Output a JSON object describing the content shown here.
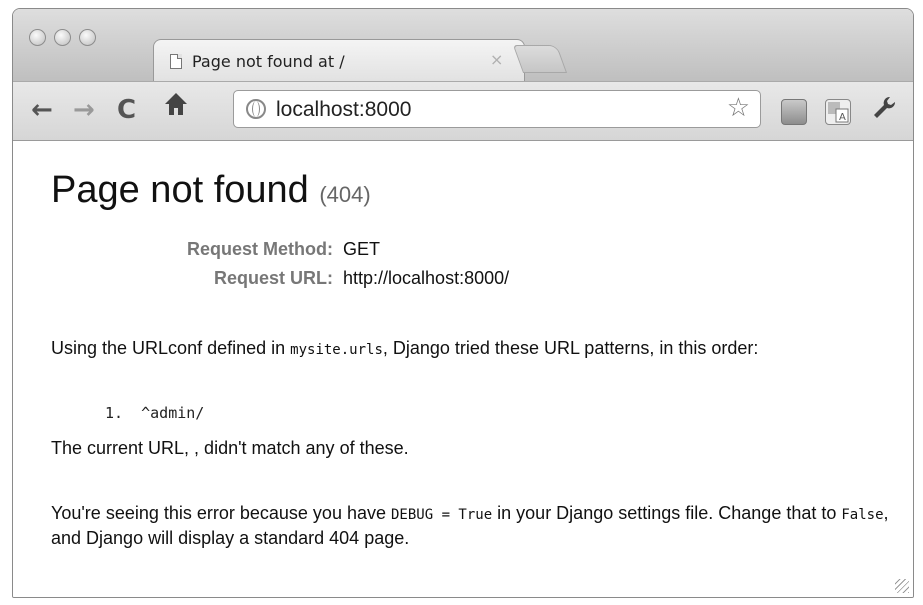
{
  "browser": {
    "tab_title": "Page not found at /",
    "tab_close": "×",
    "url": "localhost:8000",
    "star": "☆"
  },
  "page": {
    "title": "Page not found",
    "status_code": "(404)",
    "request_method_label": "Request Method:",
    "request_method_value": "GET",
    "request_url_label": "Request URL:",
    "request_url_value": "http://localhost:8000/",
    "urlconf_text_1": "Using the URLconf defined in ",
    "urlconf_module": "mysite.urls",
    "urlconf_text_2": ", Django tried these URL patterns, in this order:",
    "patterns": [
      {
        "number": "1.",
        "pattern": "^admin/"
      }
    ],
    "no_match_text": "The current URL, , didn't match any of these.",
    "debug_text_1": "You're seeing this error because you have ",
    "debug_code": "DEBUG = True",
    "debug_text_2": " in your Django settings file. Change that to ",
    "debug_false": "False",
    "debug_text_3": ", and Django will display a standard 404 page."
  },
  "icons": {
    "back": "back-arrow-icon",
    "forward": "forward-arrow-icon",
    "reload": "reload-icon",
    "home": "home-icon",
    "globe": "globe-icon",
    "bookmark": "star-icon",
    "extension1": "extension-icon",
    "translate": "translate-icon",
    "wrench": "wrench-icon"
  }
}
